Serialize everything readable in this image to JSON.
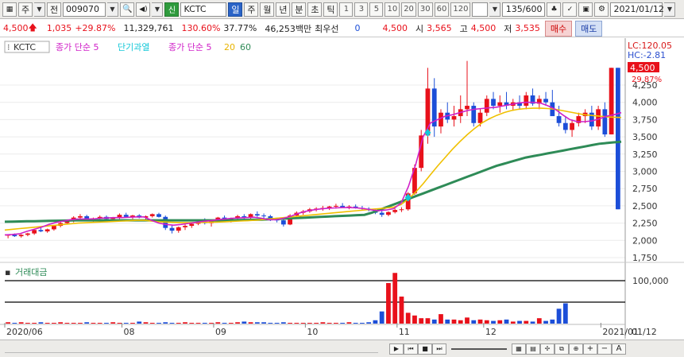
{
  "toolbar": {
    "period_type": "주",
    "view_mode": "전",
    "stock_code": "009070",
    "stock_name": "KCTC",
    "credit_badge": "신",
    "period_tabs": [
      "일",
      "주",
      "월",
      "년",
      "분",
      "초",
      "틱"
    ],
    "minute_options": [
      "1",
      "3",
      "5",
      "10",
      "20",
      "30",
      "60",
      "120"
    ],
    "count_display": "135/600",
    "date": "2021/01/12"
  },
  "pricebar": {
    "price": "4,500",
    "change": "1,035",
    "change_pct": "+29.87%",
    "volume": "11,329,761",
    "vol_ratio": "130.60%",
    "turnover": "37.77%",
    "amount": "46,253백만",
    "priority_label": "최우선",
    "priority_value": "0",
    "best_price": "4,500",
    "open_label": "시",
    "open": "3,565",
    "high_label": "고",
    "high": "4,500",
    "low_label": "저",
    "low": "3,535",
    "buy_button": "매수",
    "sell_button": "매도"
  },
  "chart": {
    "symbol_label": "KCTC",
    "legend": [
      {
        "text": "종가 단순 5",
        "color": "#d020c8"
      },
      {
        "text": "단기과열",
        "color": "#14c8d8"
      },
      {
        "text": "종가 단순 5",
        "color": "#d020c8"
      },
      {
        "text": "20",
        "color": "#e8b400"
      },
      {
        "text": "60",
        "color": "#2e8b57"
      }
    ],
    "lc_label": "LC:120.05",
    "hc_label": "HC:-2.81",
    "last_price_tag": "4,500",
    "last_pct_tag": "29.87%",
    "volume_panel_label": "거래대금",
    "volume_axis_label": "100,000",
    "colors": {
      "up": "#e8111b",
      "down": "#1c4ed8",
      "ma5": "#d020c8",
      "ma20": "#f0c000",
      "ma60": "#2e8b57"
    }
  },
  "chart_data": {
    "type": "candlestick",
    "y_ticks": [
      "4,250",
      "4,000",
      "3,750",
      "3,500",
      "3,250",
      "3,000",
      "2,750",
      "2,500",
      "2,250",
      "2,000",
      "1,750"
    ],
    "y_values": [
      4250,
      4000,
      3750,
      3500,
      3250,
      3000,
      2750,
      2500,
      2250,
      2000,
      1750
    ],
    "x_ticks": [
      "2020/06",
      "08",
      "09",
      "10",
      "11",
      "12",
      "2021/01"
    ],
    "x_end_label": "01/12",
    "candles": [
      [
        2070,
        2090,
        2030,
        2080
      ],
      [
        2080,
        2100,
        2050,
        2060
      ],
      [
        2060,
        2090,
        2040,
        2080
      ],
      [
        2080,
        2110,
        2060,
        2100
      ],
      [
        2100,
        2160,
        2080,
        2150
      ],
      [
        2150,
        2190,
        2120,
        2130
      ],
      [
        2130,
        2170,
        2110,
        2160
      ],
      [
        2160,
        2220,
        2140,
        2210
      ],
      [
        2210,
        2270,
        2190,
        2250
      ],
      [
        2250,
        2300,
        2230,
        2280
      ],
      [
        2280,
        2350,
        2260,
        2330
      ],
      [
        2330,
        2380,
        2300,
        2350
      ],
      [
        2350,
        2370,
        2280,
        2300
      ],
      [
        2300,
        2330,
        2270,
        2320
      ],
      [
        2320,
        2360,
        2290,
        2340
      ],
      [
        2340,
        2360,
        2300,
        2310
      ],
      [
        2310,
        2340,
        2280,
        2330
      ],
      [
        2330,
        2390,
        2310,
        2370
      ],
      [
        2370,
        2400,
        2330,
        2340
      ],
      [
        2340,
        2370,
        2310,
        2360
      ],
      [
        2360,
        2380,
        2320,
        2330
      ],
      [
        2330,
        2360,
        2300,
        2350
      ],
      [
        2350,
        2390,
        2330,
        2380
      ],
      [
        2380,
        2400,
        2330,
        2340
      ],
      [
        2340,
        2360,
        2150,
        2180
      ],
      [
        2180,
        2220,
        2100,
        2140
      ],
      [
        2140,
        2200,
        2110,
        2190
      ],
      [
        2190,
        2240,
        2150,
        2210
      ],
      [
        2210,
        2260,
        2180,
        2240
      ],
      [
        2240,
        2290,
        2220,
        2270
      ],
      [
        2270,
        2320,
        2230,
        2250
      ],
      [
        2250,
        2290,
        2200,
        2280
      ],
      [
        2280,
        2340,
        2260,
        2330
      ],
      [
        2330,
        2360,
        2290,
        2300
      ],
      [
        2300,
        2330,
        2260,
        2320
      ],
      [
        2320,
        2370,
        2300,
        2350
      ],
      [
        2350,
        2380,
        2310,
        2330
      ],
      [
        2330,
        2390,
        2310,
        2380
      ],
      [
        2380,
        2420,
        2340,
        2360
      ],
      [
        2360,
        2390,
        2320,
        2350
      ],
      [
        2350,
        2370,
        2280,
        2300
      ],
      [
        2300,
        2320,
        2260,
        2290
      ],
      [
        2290,
        2310,
        2200,
        2230
      ],
      [
        2230,
        2380,
        2220,
        2360
      ],
      [
        2360,
        2420,
        2340,
        2400
      ],
      [
        2400,
        2440,
        2370,
        2420
      ],
      [
        2420,
        2470,
        2400,
        2450
      ],
      [
        2450,
        2480,
        2420,
        2460
      ],
      [
        2460,
        2500,
        2430,
        2470
      ],
      [
        2470,
        2500,
        2440,
        2490
      ],
      [
        2490,
        2530,
        2460,
        2500
      ],
      [
        2500,
        2540,
        2470,
        2480
      ],
      [
        2480,
        2510,
        2450,
        2490
      ],
      [
        2490,
        2520,
        2460,
        2470
      ],
      [
        2470,
        2500,
        2430,
        2460
      ],
      [
        2460,
        2480,
        2420,
        2440
      ],
      [
        2440,
        2460,
        2380,
        2400
      ],
      [
        2400,
        2430,
        2340,
        2370
      ],
      [
        2370,
        2420,
        2350,
        2410
      ],
      [
        2410,
        2460,
        2390,
        2440
      ],
      [
        2440,
        2480,
        2410,
        2450
      ],
      [
        2450,
        2700,
        2430,
        2680
      ],
      [
        2680,
        3100,
        2660,
        3050
      ],
      [
        3050,
        3600,
        3000,
        3520
      ],
      [
        3520,
        4500,
        3400,
        4200
      ],
      [
        4200,
        4350,
        3500,
        3650
      ],
      [
        3650,
        3900,
        3550,
        3850
      ],
      [
        3850,
        4000,
        3700,
        3750
      ],
      [
        3750,
        3950,
        3650,
        3800
      ],
      [
        3800,
        4100,
        3700,
        3900
      ],
      [
        3900,
        4600,
        3800,
        3950
      ],
      [
        3950,
        4000,
        3650,
        3700
      ],
      [
        3700,
        3900,
        3650,
        3850
      ],
      [
        3850,
        4100,
        3800,
        4050
      ],
      [
        4050,
        4150,
        3900,
        3950
      ],
      [
        3950,
        4100,
        3850,
        4000
      ],
      [
        4000,
        4150,
        3900,
        3950
      ],
      [
        3950,
        4050,
        3880,
        4000
      ],
      [
        4000,
        4100,
        3900,
        3950
      ],
      [
        3950,
        4150,
        3900,
        4100
      ],
      [
        4100,
        4200,
        3950,
        3980
      ],
      [
        3980,
        4100,
        3900,
        4050
      ],
      [
        4050,
        4150,
        3950,
        4000
      ],
      [
        4000,
        4180,
        3900,
        3800
      ],
      [
        3800,
        3950,
        3650,
        3700
      ],
      [
        3700,
        3800,
        3550,
        3600
      ],
      [
        3600,
        3750,
        3500,
        3700
      ],
      [
        3700,
        3850,
        3650,
        3800
      ],
      [
        3800,
        3900,
        3700,
        3850
      ],
      [
        3850,
        3950,
        3600,
        3650
      ],
      [
        3650,
        3950,
        3600,
        3900
      ],
      [
        3900,
        4000,
        3500,
        3535
      ],
      [
        3535,
        4500,
        3535,
        4500
      ],
      [
        4500,
        4500,
        2450,
        2450
      ]
    ],
    "ma5": [
      2080,
      2085,
      2095,
      2130,
      2160,
      2190,
      2230,
      2260,
      2280,
      2300,
      2310,
      2310,
      2310,
      2320,
      2325,
      2330,
      2330,
      2335,
      2340,
      2340,
      2290,
      2250,
      2230,
      2220,
      2230,
      2245,
      2260,
      2275,
      2285,
      2300,
      2310,
      2320,
      2325,
      2330,
      2335,
      2320,
      2300,
      2300,
      2320,
      2350,
      2390,
      2420,
      2440,
      2455,
      2465,
      2470,
      2475,
      2475,
      2470,
      2460,
      2440,
      2430,
      2440,
      2460,
      2540,
      2780,
      3100,
      3500,
      3700,
      3750,
      3800,
      3820,
      3850,
      3880,
      3900,
      3910,
      3920,
      3930,
      3950,
      3970,
      3990,
      4000,
      4000,
      3990,
      3950,
      3900,
      3820,
      3750,
      3720,
      3720,
      3730,
      3760,
      3800,
      3820,
      3850
    ],
    "ma20": [
      2150,
      2160,
      2170,
      2180,
      2190,
      2200,
      2210,
      2220,
      2230,
      2240,
      2250,
      2255,
      2260,
      2265,
      2270,
      2275,
      2280,
      2285,
      2290,
      2290,
      2280,
      2270,
      2265,
      2260,
      2258,
      2256,
      2258,
      2260,
      2262,
      2265,
      2270,
      2275,
      2280,
      2285,
      2290,
      2300,
      2310,
      2320,
      2330,
      2340,
      2350,
      2360,
      2370,
      2380,
      2390,
      2400,
      2410,
      2420,
      2430,
      2440,
      2450,
      2460,
      2470,
      2480,
      2520,
      2600,
      2700,
      2820,
      2950,
      3080,
      3200,
      3320,
      3430,
      3530,
      3620,
      3700,
      3760,
      3810,
      3850,
      3880,
      3900,
      3910,
      3915,
      3915,
      3910,
      3900,
      3880,
      3860,
      3840,
      3820,
      3810,
      3800,
      3790,
      3785,
      3780
    ],
    "ma60": [
      2270,
      2272,
      2274,
      2276,
      2278,
      2280,
      2282,
      2284,
      2286,
      2288,
      2290,
      2290,
      2290,
      2290,
      2290,
      2290,
      2290,
      2290,
      2290,
      2290,
      2290,
      2290,
      2290,
      2290,
      2290,
      2290,
      2290,
      2290,
      2290,
      2290,
      2290,
      2292,
      2294,
      2296,
      2298,
      2300,
      2305,
      2310,
      2315,
      2320,
      2325,
      2330,
      2335,
      2340,
      2345,
      2350,
      2355,
      2360,
      2365,
      2370,
      2400,
      2440,
      2480,
      2520,
      2560,
      2600,
      2640,
      2680,
      2720,
      2760,
      2800,
      2840,
      2880,
      2920,
      2960,
      3000,
      3040,
      3080,
      3110,
      3140,
      3170,
      3200,
      3220,
      3240,
      3260,
      3280,
      3300,
      3320,
      3340,
      3360,
      3380,
      3400,
      3410,
      3420,
      3430
    ],
    "volume": [
      2,
      1,
      2,
      1,
      1,
      2,
      1,
      1,
      2,
      1,
      1,
      1,
      2,
      1,
      1,
      1,
      2,
      1,
      1,
      1,
      3,
      2,
      1,
      1,
      2,
      1,
      1,
      2,
      1,
      1,
      1,
      1,
      2,
      1,
      1,
      2,
      3,
      2,
      2,
      2,
      1,
      1,
      2,
      1,
      1,
      1,
      1,
      1,
      2,
      1,
      1,
      1,
      2,
      1,
      1,
      2,
      5,
      18,
      60,
      75,
      40,
      16,
      12,
      8,
      8,
      6,
      14,
      6,
      6,
      5,
      9,
      5,
      6,
      5,
      4,
      5,
      6,
      3,
      4,
      4,
      3,
      8,
      4,
      6,
      22,
      30
    ]
  },
  "footer": {
    "icons": [
      "first-page-icon",
      "prev-icon",
      "stop-icon",
      "next-icon",
      "zoom-slider",
      "grid-icon",
      "bars-icon",
      "crosshair-icon",
      "plus-icon",
      "minus-icon",
      "text-a-icon"
    ]
  }
}
